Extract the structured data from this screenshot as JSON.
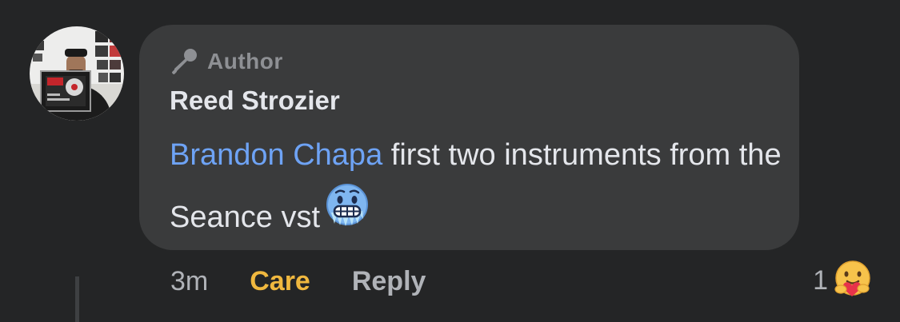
{
  "comment": {
    "badge": {
      "icon": "microphone-icon",
      "label": "Author"
    },
    "author_name": "Reed Strozier",
    "mention": "Brandon Chapa",
    "text": " first two instruments from the Seance vst",
    "emoji": "cold-face-emoji"
  },
  "actions": {
    "time": "3m",
    "reaction_label": "Care",
    "reply_label": "Reply"
  },
  "reactions": {
    "count": "1",
    "icon": "care-hug-emoji"
  },
  "colors": {
    "background": "#242526",
    "bubble": "#3a3b3c",
    "mention": "#6ea3f5",
    "care": "#f0b83f"
  }
}
